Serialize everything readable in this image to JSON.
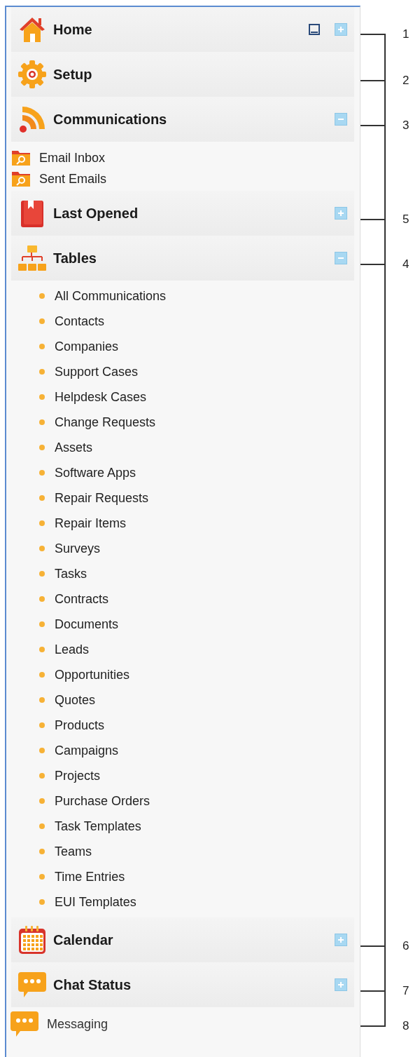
{
  "sections": [
    {
      "kind": "header",
      "title": "Home",
      "window_button": true,
      "expanded": false,
      "callout": "1"
    },
    {
      "kind": "header",
      "title": "Setup",
      "callout": "2"
    },
    {
      "kind": "header",
      "title": "Communications",
      "expanded": true,
      "callout": "3",
      "items": [
        {
          "kind": "folder",
          "label": "Email Inbox"
        },
        {
          "kind": "folder",
          "label": "Sent Emails"
        }
      ]
    },
    {
      "kind": "header",
      "title": "Last Opened",
      "expanded": false,
      "callout": "5"
    },
    {
      "kind": "header",
      "title": "Tables",
      "expanded": true,
      "callout": "4",
      "items": [
        {
          "kind": "bullet",
          "label": "All Communications"
        },
        {
          "kind": "bullet",
          "label": "Contacts"
        },
        {
          "kind": "bullet",
          "label": "Companies"
        },
        {
          "kind": "bullet",
          "label": "Support Cases"
        },
        {
          "kind": "bullet",
          "label": "Helpdesk Cases"
        },
        {
          "kind": "bullet",
          "label": "Change Requests"
        },
        {
          "kind": "bullet",
          "label": "Assets"
        },
        {
          "kind": "bullet",
          "label": "Software Apps"
        },
        {
          "kind": "bullet",
          "label": "Repair Requests"
        },
        {
          "kind": "bullet",
          "label": "Repair Items"
        },
        {
          "kind": "bullet",
          "label": "Surveys"
        },
        {
          "kind": "bullet",
          "label": "Tasks"
        },
        {
          "kind": "bullet",
          "label": "Contracts"
        },
        {
          "kind": "bullet",
          "label": "Documents"
        },
        {
          "kind": "bullet",
          "label": "Leads"
        },
        {
          "kind": "bullet",
          "label": "Opportunities"
        },
        {
          "kind": "bullet",
          "label": "Quotes"
        },
        {
          "kind": "bullet",
          "label": "Products"
        },
        {
          "kind": "bullet",
          "label": "Campaigns"
        },
        {
          "kind": "bullet",
          "label": "Projects"
        },
        {
          "kind": "bullet",
          "label": "Purchase Orders"
        },
        {
          "kind": "bullet",
          "label": "Task Templates"
        },
        {
          "kind": "bullet",
          "label": "Teams"
        },
        {
          "kind": "bullet",
          "label": "Time Entries"
        },
        {
          "kind": "bullet",
          "label": "EUI Templates"
        }
      ]
    },
    {
      "kind": "header",
      "title": "Calendar",
      "expanded": false,
      "callout": "6"
    },
    {
      "kind": "header",
      "title": "Chat Status",
      "expanded": false,
      "callout": "7"
    },
    {
      "kind": "link",
      "title": "Messaging",
      "callout": "8"
    }
  ]
}
